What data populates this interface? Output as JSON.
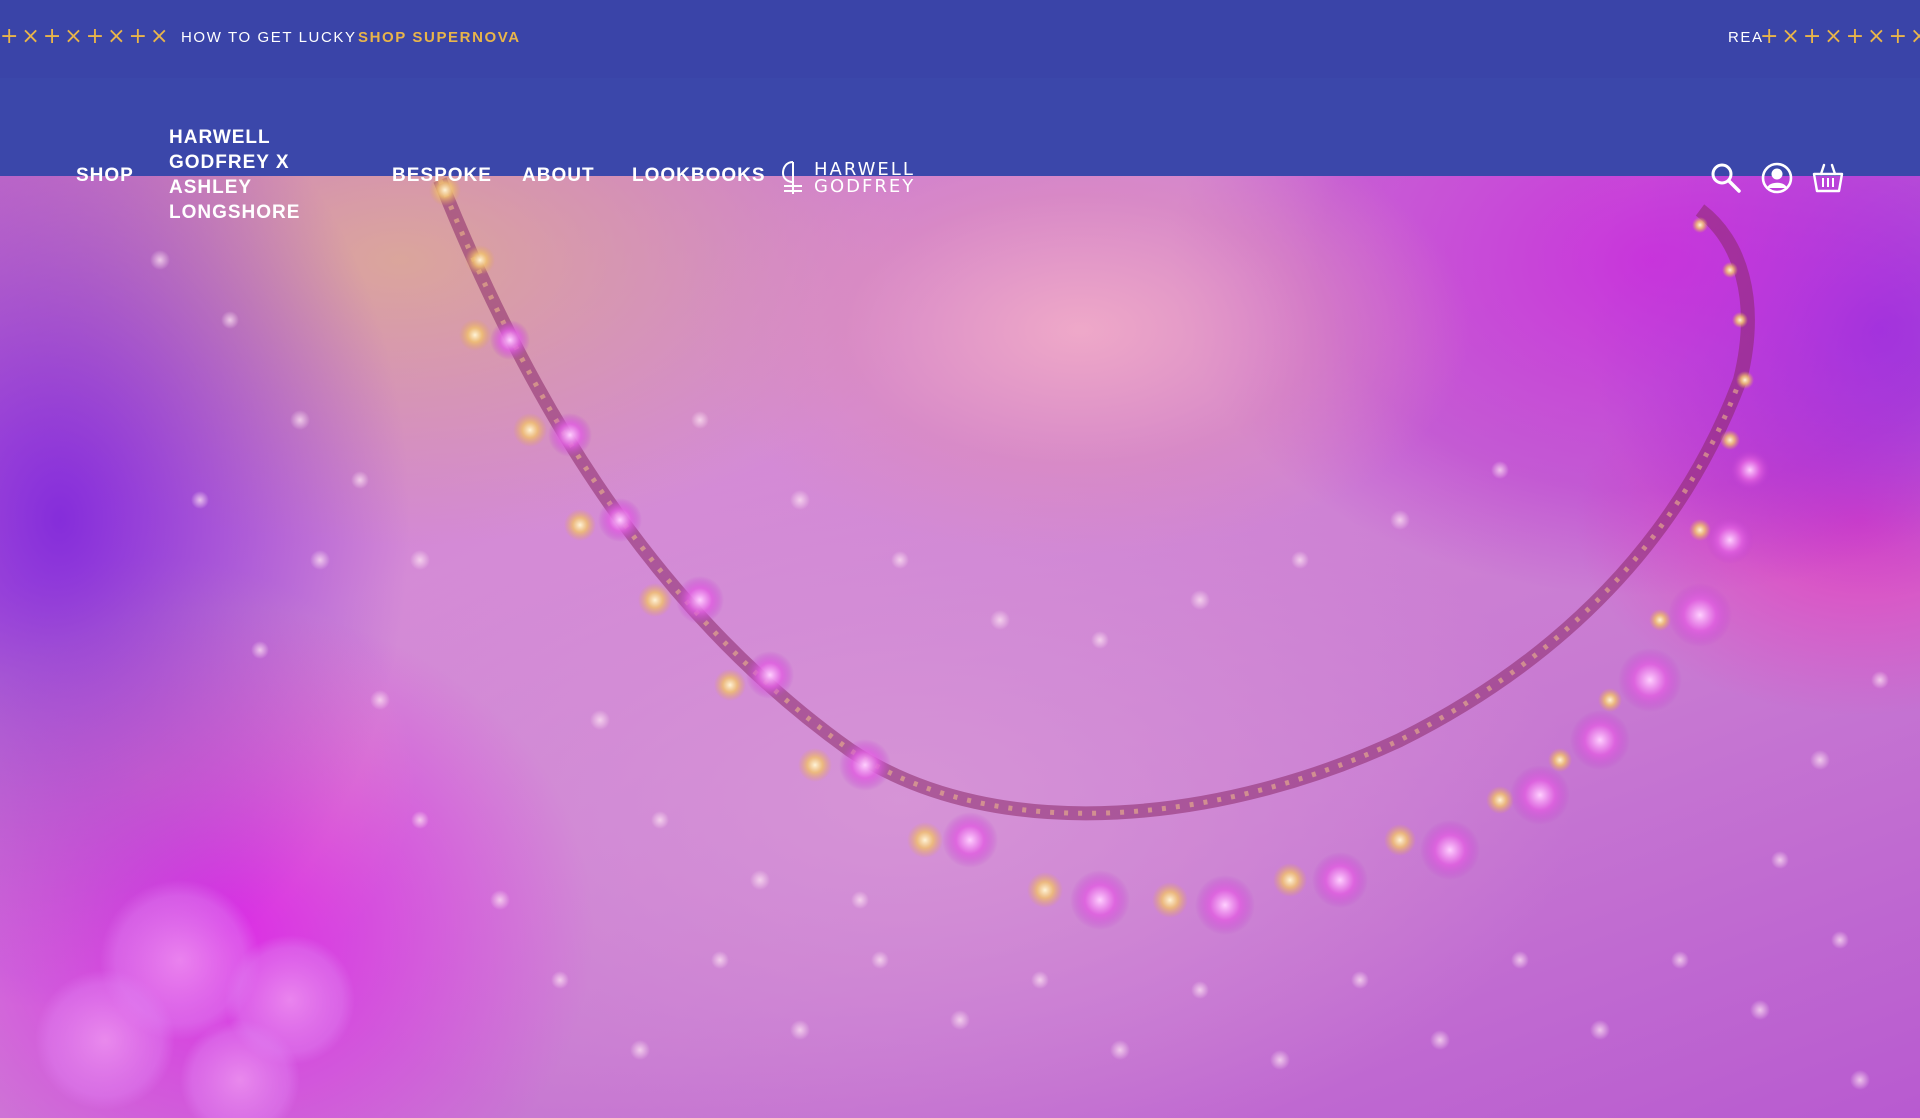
{
  "announcement": {
    "left_marks": "+×+×+×+×",
    "message": "HOW TO GET LUCKY",
    "link": "SHOP SUPERNOVA",
    "right_message": "REA",
    "right_marks": "+×+×+×+×",
    "accent_color": "#e9b54a"
  },
  "header": {
    "nav": [
      {
        "label": "SHOP"
      },
      {
        "label": "HARWELL GODFREY X ASHLEY LONGSHORE"
      },
      {
        "label": "BESPOKE"
      },
      {
        "label": "ABOUT"
      },
      {
        "label": "LOOKBOOKS"
      }
    ],
    "logo": {
      "line1": "HARWELL",
      "line2": "GODFREY"
    },
    "icons": [
      "search-icon",
      "account-icon",
      "basket-icon"
    ],
    "background_color": "#3b47aa"
  }
}
